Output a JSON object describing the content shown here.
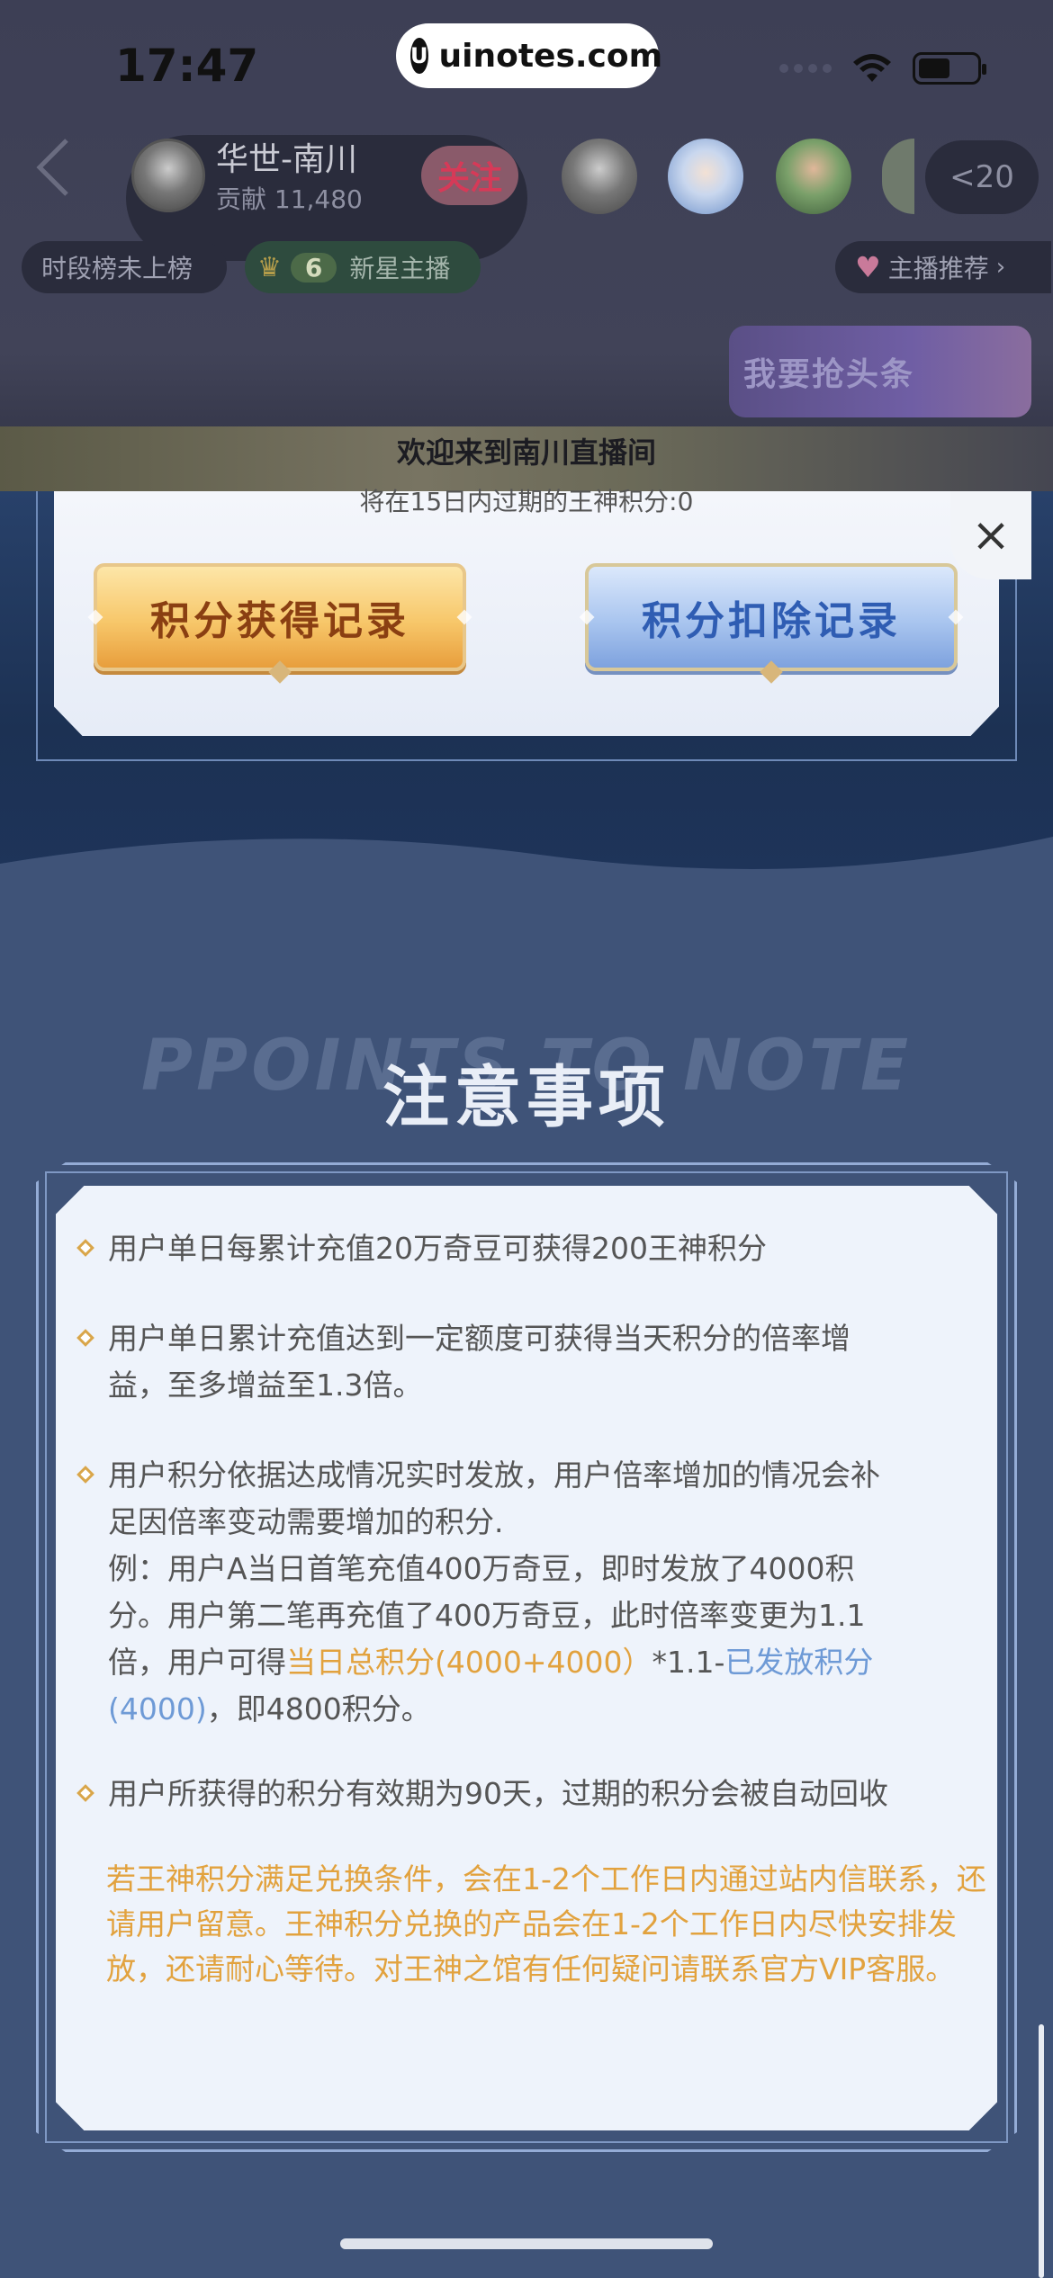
{
  "status_bar": {
    "time": "17:47",
    "watermark": "uinotes.com"
  },
  "live_room": {
    "anchor_name": "华世-南川",
    "anchor_contribution": "贡献 11,480",
    "follow_label": "关注",
    "viewer_count": "<20",
    "rank_tag": "时段榜未上榜",
    "star_level": "6",
    "star_tag": "新星主播",
    "recommend_tag": "主播推荐",
    "headline_banner": "我要抢头条",
    "welcome_text": "欢迎来到南川直播间"
  },
  "points_panel": {
    "expire_text": "将在15日内过期的王神积分:0",
    "close_symbol": "×",
    "earn_record_label": "积分获得记录",
    "deduct_record_label": "积分扣除记录"
  },
  "notes": {
    "title_en": "PPOINTS TO NOTE",
    "title_cn": "注意事项",
    "items": [
      {
        "text": "用户单日每累计充值20万奇豆可获得200王神积分"
      },
      {
        "line1": "用户单日累计充值达到一定额度可获得当天积分的倍率增",
        "line2": "益，至多增益至1.3倍。"
      },
      {
        "line1": "用户积分依据达成情况实时发放，用户倍率增加的情况会补",
        "line2": "足因倍率变动需要增加的积分.",
        "line3": "例：用户A当日首笔充值400万奇豆，即时发放了4000积",
        "line4": "分。用户第二笔再充值了400万奇豆，此时倍率变更为1.1",
        "line5_prefix": "倍，用户可得",
        "line5_orange": "当日总积分(4000+4000）",
        "line5_mid": "*1.1-",
        "line5_blue": "已发放积分",
        "line6_blue": "(4000)",
        "line6_suffix": "，即4800积分。"
      },
      {
        "text": "用户所获得的积分有效期为90天，过期的积分会被自动回收"
      }
    ],
    "final_line1": "若王神积分满足兑换条件，会在1-2个工作日内通过站内信联系，还",
    "final_line2": "请用户留意。王神积分兑换的产品会在1-2个工作日内尽快安排发",
    "final_line3": "放，还请耐心等待。对王神之馆有任何疑问请联系官方VIP客服。"
  },
  "icons": [
    "back-chevron-icon",
    "wifi-icon",
    "battery-icon",
    "crown-icon",
    "heart-icon",
    "close-icon",
    "bullet-diamond-icon"
  ],
  "colors": {
    "highlight_orange": "#e2a23e",
    "highlight_blue": "#6e9ad6",
    "earn_button": "#f7c76a",
    "deduct_button": "#a9c5ef"
  }
}
